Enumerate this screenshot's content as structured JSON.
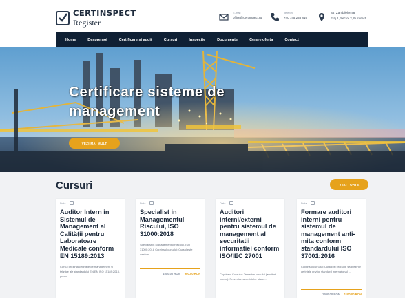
{
  "brand": {
    "line1": "CERTINSPECT",
    "line2": "Register"
  },
  "contact": {
    "email": {
      "label": "E-mail",
      "value": "office@certinspect.ro"
    },
    "phone": {
      "label": "Telefon",
      "value": "+40 745 238 819"
    },
    "address": {
      "line1": "Str. Zambilelor 48",
      "line2": "Etaj 1, Sector 2, Bucuresti"
    }
  },
  "nav": [
    "Home",
    "Despre noi",
    "Certificare si audit",
    "Cursuri",
    "Inspectie",
    "Documente",
    "Cerere oferta",
    "Contact"
  ],
  "hero": {
    "title": "Certificare sisteme de management",
    "button": "VEZI MAI MULT"
  },
  "courses": {
    "title": "Cursuri",
    "see_all": "VEZI TOATE",
    "items": [
      {
        "date": "Data",
        "title": "Auditor Intern in Sistemul de Management al Calității pentru Laboratoare Medicale conform EN 15189:2013",
        "desc": "Cursul prezinta cerintele de management si tehnice ale standardului EN EN ISO 15189:2013, precu...",
        "price_old": "",
        "price_new": ""
      },
      {
        "date": "Data",
        "title": "Specialist in Managementul Riscului, ISO 31000:2018",
        "desc": "Specialist in Managementul Riscului, ISO 31000:2018 Cuprinsul cursului: Cursul este destina...",
        "price_old": "1500.00 RON",
        "price_new": "900.00 RON"
      },
      {
        "date": "Data",
        "title": "Auditori interni/externi pentru sistemul de management al securitatii informatiei conform ISO/IEC 27001",
        "desc": "Cuprinsul Cursului: Tematica cursului (auditori interni): Prezentarea cerintelor stand...",
        "price_old": "",
        "price_new": ""
      },
      {
        "date": "Data",
        "title": "Formare auditori interni pentru sistemul de management anti-mita conform standardului ISO 37001:2016",
        "desc": "Cuprinsul cursului: Cursul isi propune sa prezinte cerintele privind standard internațional ...",
        "price_old": "1300.00 RON",
        "price_new": "1100.00 RON"
      }
    ]
  },
  "colors": {
    "accent": "#e6a21c",
    "nav_bg": "#0f2034",
    "text_dark": "#1e2b3c"
  }
}
